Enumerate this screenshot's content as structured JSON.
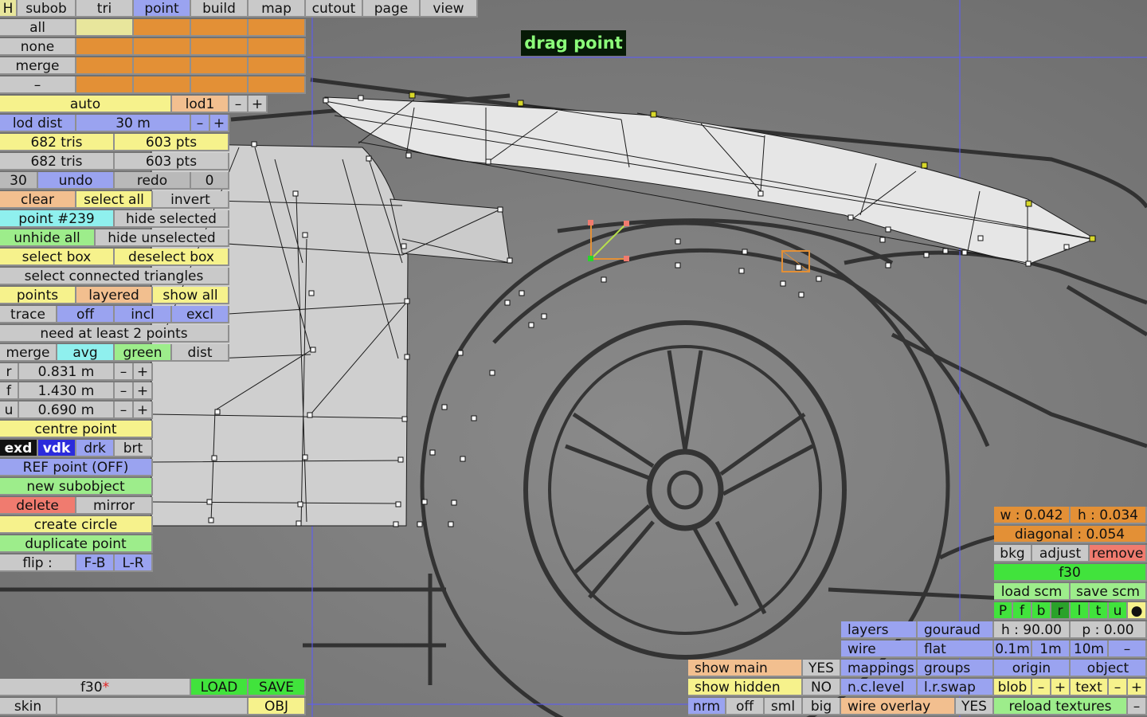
{
  "menu_bar": [
    "H",
    "subob",
    "tri",
    "point",
    "build",
    "map",
    "cutout",
    "page",
    "view"
  ],
  "selection": {
    "all": "all",
    "none": "none",
    "merge": "merge",
    "dash": "–"
  },
  "lod": {
    "auto": "auto",
    "lod_name": "lod1",
    "minus": "–",
    "plus": "+",
    "lod_dist_label": "lod dist",
    "lod_dist_value": "30 m"
  },
  "stats": {
    "tris_a": "682 tris",
    "pts_a": "603 pts",
    "tris_b": "682 tris",
    "pts_b": "603 pts"
  },
  "history": {
    "count": "30",
    "undo": "undo",
    "redo": "redo",
    "redo_count": "0"
  },
  "point_panel": {
    "clear": "clear",
    "select_all": "select all",
    "invert": "invert",
    "point_id": "point #239",
    "hide_selected": "hide selected",
    "unhide_all": "unhide all",
    "hide_unselected": "hide unselected",
    "select_box": "select box",
    "deselect_box": "deselect box",
    "select_connected": "select connected triangles",
    "points": "points",
    "layered": "layered",
    "show_all": "show all",
    "trace": "trace",
    "off": "off",
    "incl": "incl",
    "excl": "excl",
    "need_points": "need at least 2 points",
    "merge": "merge",
    "avg": "avg",
    "green": "green",
    "dist": "dist",
    "r_label": "r",
    "r_value": "0.831 m",
    "f_label": "f",
    "f_value": "1.430 m",
    "u_label": "u",
    "u_value": "0.690 m",
    "centre_point": "centre point",
    "exd": "exd",
    "vdk": "vdk",
    "drk": "drk",
    "brt": "brt",
    "ref_point": "REF point (OFF)",
    "new_subobject": "new subobject",
    "delete": "delete",
    "mirror": "mirror",
    "create_circle": "create circle",
    "duplicate_point": "duplicate point",
    "flip": "flip :",
    "fb": "F-B",
    "lr": "L-R"
  },
  "drag_label": "drag point",
  "file_bar": {
    "name": "f30",
    "modified": "*",
    "load": "LOAD",
    "save": "SAVE",
    "skin": "skin",
    "obj": "OBJ"
  },
  "display": {
    "show_main": "show main",
    "yes1": "YES",
    "show_hidden": "show hidden",
    "no": "NO",
    "nrm": "nrm",
    "off": "off",
    "sml": "sml",
    "big": "big"
  },
  "render": {
    "layers": "layers",
    "gouraud": "gouraud",
    "wire": "wire",
    "flat": "flat",
    "mappings": "mappings",
    "groups": "groups",
    "nclevel": "n.c.level",
    "lrswap": "l.r.swap",
    "wire_overlay": "wire overlay",
    "yes2": "YES"
  },
  "bg_panel": {
    "w": "w : 0.042",
    "h": "h : 0.034",
    "diagonal": "diagonal : 0.054",
    "bkg": "bkg",
    "adjust": "adjust",
    "remove": "remove",
    "name": "f30",
    "load_scm": "load scm",
    "save_scm": "save scm",
    "views": [
      "P",
      "f",
      "b",
      "r",
      "l",
      "t",
      "u",
      "●"
    ],
    "heading": "h : 90.00",
    "pitch": "p : 0.00",
    "step1": "0.1m",
    "step2": "1m",
    "step3": "10m",
    "step_minus": "–",
    "origin": "origin",
    "object": "object",
    "blob": "blob",
    "blob_minus": "–",
    "blob_plus": "+",
    "text": "text",
    "text_minus": "–",
    "text_plus": "+",
    "reload": "reload textures",
    "reload_minus": "–"
  },
  "colors": {
    "accent": "#e39036",
    "wire": "#1b1b1b",
    "selected": "#d8d82a"
  }
}
